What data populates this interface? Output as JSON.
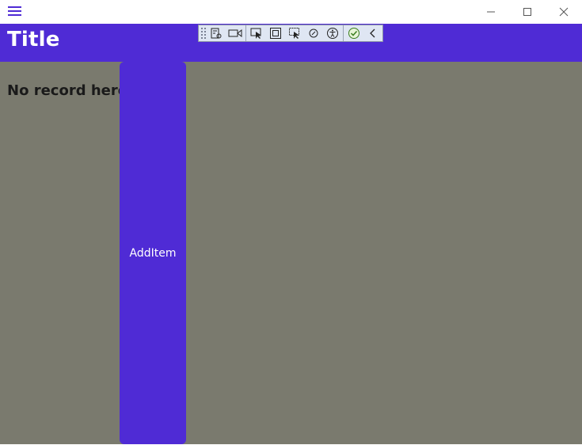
{
  "window": {
    "controls": {
      "minimize_icon": "minimize-icon",
      "maximize_icon": "maximize-icon",
      "close_icon": "close-icon"
    }
  },
  "header": {
    "title": "Title"
  },
  "debug_toolbar": {
    "icons": [
      "live-visual-tree-icon",
      "record-icon",
      "select-element-icon",
      "display-layout-adorners-icon",
      "track-focused-element-icon",
      "binding-failures-icon",
      "accessibility-icon",
      "hot-reload-status-icon",
      "collapse-icon"
    ]
  },
  "main": {
    "empty_message": "No record here",
    "add_button_label": "AddItem"
  },
  "colors": {
    "accent": "#4f2bd5",
    "content_background": "#7a7a6e",
    "titlebar_background": "#ffffff"
  }
}
